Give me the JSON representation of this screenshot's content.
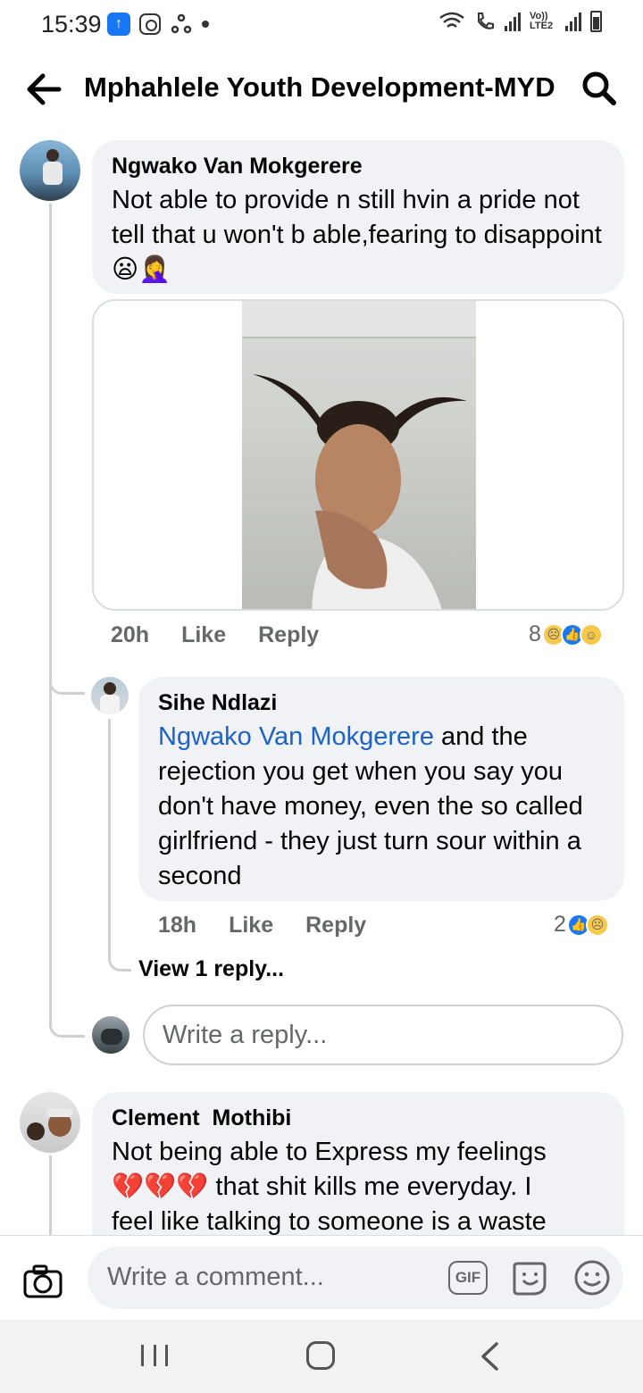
{
  "status_bar": {
    "time": "15:39",
    "app_icons": [
      "facebook-lite-icon",
      "instagram-icon",
      "recycle-icon",
      "dot-icon"
    ],
    "right_icons": [
      "wifi-icon",
      "wifi-calling-icon",
      "signal-icon",
      "volte-icon",
      "signal-icon",
      "battery-icon"
    ],
    "volte_label": "Vo)) LTE2"
  },
  "header": {
    "title": "Mphahlele Youth Development-MYD"
  },
  "comments": [
    {
      "author": "Ngwako Van Mokgerere",
      "text": "Not able to provide n still hvin a pride not tell that u won't b able,fearing to disappoint",
      "emojis": [
        "😦",
        "🤦‍♀️"
      ],
      "time": "20h",
      "like_label": "Like",
      "reply_label": "Reply",
      "reaction_count": "8",
      "reactions": [
        "sad",
        "like",
        "haha"
      ]
    },
    {
      "author": "Sihe Ndlazi",
      "mention": "Ngwako Van Mokgerere",
      "text": "and the rejection you get when you say you don't have money, even the so called girlfriend - they just turn sour within a second",
      "time": "18h",
      "like_label": "Like",
      "reply_label": "Reply",
      "reaction_count": "2",
      "reactions": [
        "like",
        "sad"
      ]
    },
    {
      "author": "Clement  Mothibi",
      "text_start": "Not being able to Express my feelings",
      "emojis": [
        "💔",
        "💔",
        "💔"
      ],
      "text_after_emojis": "that shit kills me everyday. I",
      "text_end": "feel like talking to someone is a waste"
    }
  ],
  "view_replies": "View 1 reply...",
  "reply_input": {
    "placeholder": "Write a reply..."
  },
  "composer": {
    "placeholder": "Write a comment...",
    "gif_label": "GIF"
  },
  "colors": {
    "bubble": "#f0f2f5",
    "mention": "#1b62c9",
    "like_blue": "#1877f2",
    "meta_gray": "#65676b"
  }
}
